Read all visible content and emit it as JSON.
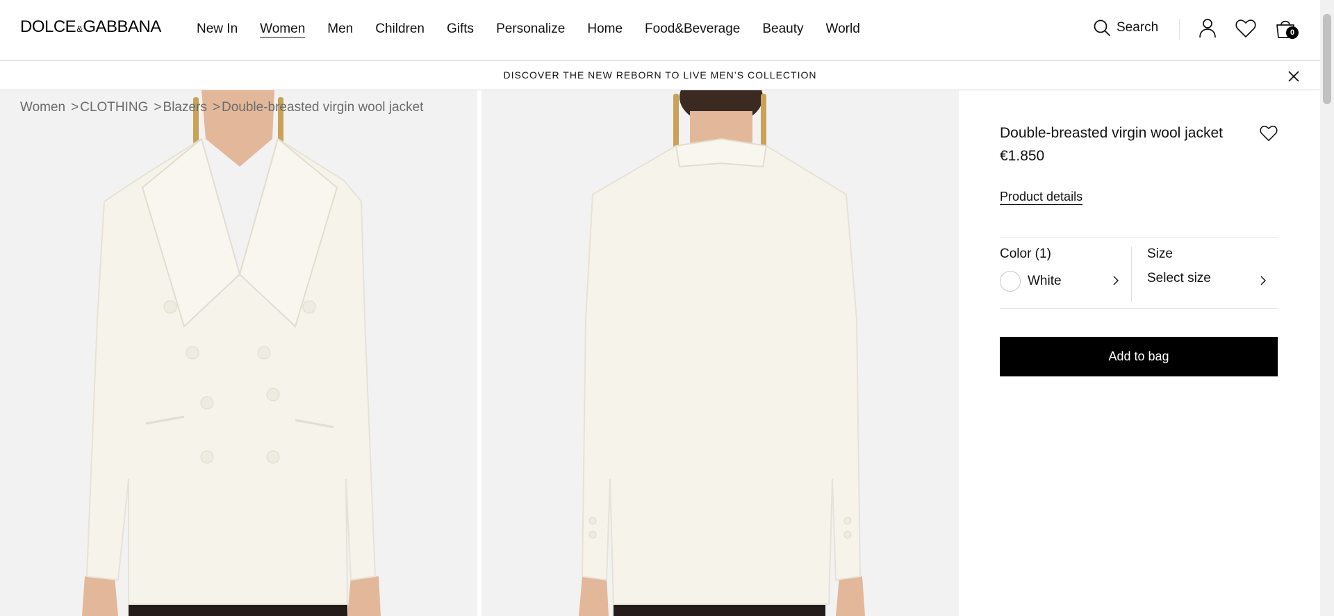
{
  "brand": {
    "logo_left": "DOLCE",
    "logo_amp": "&",
    "logo_right": "GABBANA"
  },
  "nav": {
    "items": [
      {
        "label": "New In"
      },
      {
        "label": "Women",
        "active": true
      },
      {
        "label": "Men"
      },
      {
        "label": "Children"
      },
      {
        "label": "Gifts"
      },
      {
        "label": "Personalize"
      },
      {
        "label": "Home"
      },
      {
        "label": "Food&Beverage"
      },
      {
        "label": "Beauty"
      },
      {
        "label": "World"
      }
    ]
  },
  "header": {
    "search_label": "Search",
    "bag_count": "0"
  },
  "promo": {
    "text": "DISCOVER THE NEW REBORN TO LIVE MEN’S COLLECTION"
  },
  "breadcrumb": {
    "items": [
      "Women",
      "CLOTHING",
      "Blazers",
      "Double-breasted virgin wool jacket"
    ],
    "separator": ">"
  },
  "product": {
    "title": "Double-breasted virgin wool jacket",
    "price": "€1.850",
    "details_link": "Product details",
    "color_label": "Color (1)",
    "color_value": "White",
    "size_label": "Size",
    "size_value": "Select size",
    "add_to_bag": "Add to bag"
  },
  "colors": {
    "jacket": "#f6f3ea",
    "background": "#f2f2f2",
    "trousers": "#231c1a",
    "skin": "#e3b79a",
    "gold": "#c9a257"
  }
}
